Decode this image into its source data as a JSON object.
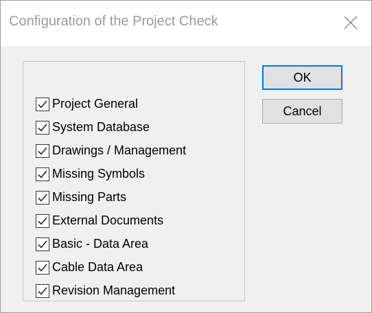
{
  "window": {
    "title": "Configuration of the Project Check"
  },
  "buttons": {
    "ok_label": "OK",
    "cancel_label": "Cancel"
  },
  "checks": [
    {
      "label": "Project General",
      "checked": true
    },
    {
      "label": "System Database",
      "checked": true
    },
    {
      "label": "Drawings / Management",
      "checked": true
    },
    {
      "label": "Missing Symbols",
      "checked": true
    },
    {
      "label": "Missing Parts",
      "checked": true
    },
    {
      "label": "External Documents",
      "checked": true
    },
    {
      "label": "Basic - Data Area",
      "checked": true
    },
    {
      "label": "Cable Data Area",
      "checked": true
    },
    {
      "label": "Revision Management",
      "checked": true
    }
  ],
  "icons": {
    "close": "close-icon",
    "check": "checkmark-icon"
  },
  "colors": {
    "dialog_bg": "#f0f0f0",
    "title_text": "#9a9a9a",
    "default_button_border": "#0078d7",
    "button_bg": "#e1e1e1"
  }
}
